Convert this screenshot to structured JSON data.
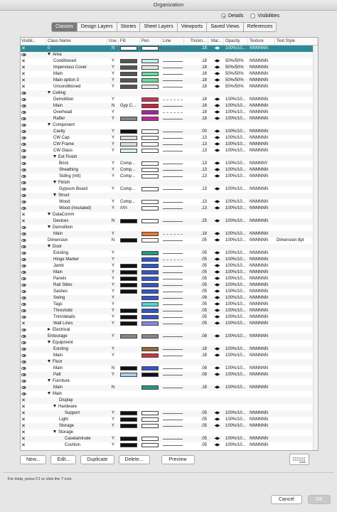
{
  "window": {
    "title": "Organization"
  },
  "view_mode": {
    "options": [
      "Details",
      "Visibilities"
    ],
    "selected": "Details"
  },
  "tabs": [
    "Classes",
    "Design Layers",
    "Stories",
    "Sheet Layers",
    "Viewports",
    "Saved Views",
    "References"
  ],
  "active_tab": "Classes",
  "columns": [
    "Visibil...",
    "Class Name",
    "Use",
    "Fill",
    "Pen",
    "Line",
    "Thickn...",
    "Mar...",
    "Opacity",
    "Texture",
    "Text Style"
  ],
  "rows": [
    {
      "vis": "x",
      "name": "0",
      "indent": 0,
      "tri": "",
      "use": "N",
      "fill": "#ffffff",
      "pen": "#ffffff",
      "line": "solid",
      "thick": ".18",
      "opac": "100%/10...",
      "tex": "NNNNNN",
      "ts": "",
      "sel": true
    },
    {
      "vis": "eye",
      "name": "Area",
      "indent": 0,
      "tri": "down",
      "use": "",
      "fill": "",
      "pen": "",
      "line": "",
      "thick": "",
      "opac": "",
      "tex": "",
      "ts": ""
    },
    {
      "vis": "x",
      "name": "Conditioned",
      "indent": 2,
      "tri": "",
      "use": "Y",
      "fill": "#555555",
      "pen": "#c8eaf0",
      "line": "solid",
      "thick": ".18",
      "opac": "50%/50%",
      "tex": "NNNNNN",
      "ts": ""
    },
    {
      "vis": "x",
      "name": "Impervious Cover",
      "indent": 2,
      "tri": "",
      "use": "Y",
      "fill": "#555555",
      "pen": "#e8e8e8",
      "line": "solid",
      "thick": ".18",
      "opac": "50%/50%",
      "tex": "NNNNNN",
      "ts": ""
    },
    {
      "vis": "x",
      "name": "Main",
      "indent": 2,
      "tri": "",
      "use": "Y",
      "fill": "#555555",
      "pen": "#66dd99",
      "line": "solid",
      "thick": ".18",
      "opac": "50%/50%",
      "tex": "NNNNNN",
      "ts": ""
    },
    {
      "vis": "x",
      "name": "Main option 3",
      "indent": 2,
      "tri": "",
      "use": "Y",
      "fill": "#555555",
      "pen": "#66dd99",
      "line": "solid",
      "thick": ".18",
      "opac": "50%/50%",
      "tex": "NNNNNN",
      "ts": ""
    },
    {
      "vis": "x",
      "name": "Unconditioned",
      "indent": 2,
      "tri": "",
      "use": "Y",
      "fill": "#555555",
      "pen": "#e8e8e8",
      "line": "solid",
      "thick": ".18",
      "opac": "50%/50%",
      "tex": "NNNNNN",
      "ts": ""
    },
    {
      "vis": "eye",
      "name": "Ceiling",
      "indent": 0,
      "tri": "down",
      "use": "",
      "fill": "",
      "pen": "",
      "line": "",
      "thick": "",
      "opac": "",
      "tex": "",
      "ts": ""
    },
    {
      "vis": "eye",
      "name": "Demolition",
      "indent": 2,
      "tri": "",
      "use": "Y",
      "fill": "",
      "pen": "#cc3355",
      "line": "dash",
      "thick": ".18",
      "opac": "100%/10...",
      "tex": "NNNNNN",
      "ts": ""
    },
    {
      "vis": "eye",
      "name": "Main",
      "indent": 2,
      "tri": "",
      "use": "N",
      "fill": "Gyp C...",
      "pen": "#cc2233",
      "line": "solid",
      "thick": ".18",
      "opac": "100%/10...",
      "tex": "NNNNNN",
      "ts": ""
    },
    {
      "vis": "eye",
      "name": "Overhead",
      "indent": 2,
      "tri": "",
      "use": "Y",
      "fill": "",
      "pen": "#aa2299",
      "line": "dash",
      "thick": ".18",
      "opac": "100%/10...",
      "tex": "NNNNNN",
      "ts": ""
    },
    {
      "vis": "eye",
      "name": "Rafter",
      "indent": 2,
      "tri": "",
      "use": "Y",
      "fill": "#888888",
      "pen": "#cc2299",
      "line": "solid",
      "thick": ".18",
      "opac": "100%/10...",
      "tex": "NNNNNN",
      "ts": ""
    },
    {
      "vis": "eye",
      "name": "Component",
      "indent": 0,
      "tri": "down",
      "use": "",
      "fill": "",
      "pen": "",
      "line": "",
      "thick": "",
      "opac": "",
      "tex": "",
      "ts": ""
    },
    {
      "vis": "eye",
      "name": "Cavity",
      "indent": 2,
      "tri": "",
      "use": "Y",
      "fill": "#111111",
      "pen": "#ffffff",
      "line": "solid",
      "thick": ".00",
      "opac": "100%/10...",
      "tex": "NNNNNN",
      "ts": ""
    },
    {
      "vis": "eye",
      "name": "CW Cap",
      "indent": 2,
      "tri": "",
      "use": "Y",
      "fill": "#dddddd",
      "pen": "#ffffff",
      "line": "solid",
      "thick": ".13",
      "opac": "100%/10...",
      "tex": "NNNNNN",
      "ts": ""
    },
    {
      "vis": "eye",
      "name": "CW Frame",
      "indent": 2,
      "tri": "",
      "use": "Y",
      "fill": "#dddddd",
      "pen": "#ffffff",
      "line": "solid",
      "thick": ".13",
      "opac": "100%/10...",
      "tex": "NNNNNN",
      "ts": ""
    },
    {
      "vis": "eye",
      "name": "CW Glass",
      "indent": 2,
      "tri": "",
      "use": "Y",
      "fill": "#d8eef2",
      "pen": "#ffffff",
      "line": "solid",
      "thick": ".13",
      "opac": "100%/10...",
      "tex": "NNNNNN",
      "ts": ""
    },
    {
      "vis": "eye",
      "name": "Ext Finish",
      "indent": 2,
      "tri": "down",
      "use": "",
      "fill": "",
      "pen": "",
      "line": "",
      "thick": "",
      "opac": "",
      "tex": "",
      "ts": ""
    },
    {
      "vis": "eye",
      "name": "Brick",
      "indent": 4,
      "tri": "",
      "use": "Y",
      "fill": "Comp...",
      "pen": "#ffffff",
      "line": "solid",
      "thick": ".13",
      "opac": "100%/10...",
      "tex": "NNNNNY",
      "ts": ""
    },
    {
      "vis": "eye",
      "name": "Sheathing",
      "indent": 4,
      "tri": "",
      "use": "Y",
      "fill": "Comp...",
      "pen": "#ffffff",
      "line": "solid",
      "thick": ".13",
      "opac": "100%/10...",
      "tex": "NNNNNN",
      "ts": ""
    },
    {
      "vis": "eye",
      "name": "Siding (mtl)",
      "indent": 4,
      "tri": "",
      "use": "Y",
      "fill": "Comp...",
      "pen": "#ffffff",
      "line": "solid",
      "thick": ".13",
      "opac": "100%/10...",
      "tex": "NNNNNN",
      "ts": ""
    },
    {
      "vis": "eye",
      "name": "Finish",
      "indent": 2,
      "tri": "down",
      "use": "",
      "fill": "",
      "pen": "",
      "line": "",
      "thick": "",
      "opac": "",
      "tex": "",
      "ts": ""
    },
    {
      "vis": "eye",
      "name": "Gypsum Board",
      "indent": 4,
      "tri": "",
      "use": "Y",
      "fill": "Comp...",
      "pen": "#ffffff",
      "line": "solid",
      "thick": ".13",
      "opac": "100%/10...",
      "tex": "NNNNNN",
      "ts": ""
    },
    {
      "vis": "eye",
      "name": "Struct",
      "indent": 2,
      "tri": "down",
      "use": "",
      "fill": "",
      "pen": "",
      "line": "",
      "thick": "",
      "opac": "",
      "tex": "",
      "ts": ""
    },
    {
      "vis": "eye",
      "name": "Wood",
      "indent": 4,
      "tri": "",
      "use": "Y",
      "fill": "Comp...",
      "pen": "#ffffff",
      "line": "solid",
      "thick": ".13",
      "opac": "100%/10...",
      "tex": "NNNNNN",
      "ts": ""
    },
    {
      "vis": "eye",
      "name": "Wood (insulated)",
      "indent": 4,
      "tri": "",
      "use": "Y",
      "fill": "/\\/\\/\\",
      "pen": "#ffffff",
      "line": "solid",
      "thick": ".13",
      "opac": "100%/10...",
      "tex": "NNNNNN",
      "ts": ""
    },
    {
      "vis": "x",
      "name": "DataComm",
      "indent": 0,
      "tri": "down",
      "use": "",
      "fill": "",
      "pen": "",
      "line": "",
      "thick": "",
      "opac": "",
      "tex": "",
      "ts": ""
    },
    {
      "vis": "x",
      "name": "Devices",
      "indent": 2,
      "tri": "",
      "use": "N",
      "fill": "#111111",
      "pen": "#ffffff",
      "line": "solid",
      "thick": ".25",
      "opac": "100%/10...",
      "tex": "NNNNNN",
      "ts": ""
    },
    {
      "vis": "eye",
      "name": "Demolition",
      "indent": 0,
      "tri": "down",
      "use": "",
      "fill": "",
      "pen": "",
      "line": "",
      "thick": "",
      "opac": "",
      "tex": "",
      "ts": ""
    },
    {
      "vis": "eye",
      "name": "Main",
      "indent": 2,
      "tri": "",
      "use": "Y",
      "fill": "",
      "pen": "#ee7733",
      "line": "dash",
      "thick": ".18",
      "opac": "100%/10...",
      "tex": "NNNNNN",
      "ts": ""
    },
    {
      "vis": "eye",
      "name": "Dimension",
      "indent": 0,
      "tri": "",
      "use": "N",
      "fill": "#111111",
      "pen": "#ffffff",
      "line": "solid",
      "thick": ".05",
      "opac": "100%/10...",
      "tex": "NNNNNN",
      "ts": "Dimension 8pt"
    },
    {
      "vis": "eye",
      "name": "Door",
      "indent": 0,
      "tri": "down",
      "use": "",
      "fill": "",
      "pen": "",
      "line": "",
      "thick": "",
      "opac": "",
      "tex": "",
      "ts": ""
    },
    {
      "vis": "eye",
      "name": "Existing",
      "indent": 2,
      "tri": "",
      "use": "Y",
      "fill": "",
      "pen": "#229988",
      "line": "solid",
      "thick": ".05",
      "opac": "100%/10...",
      "tex": "NNNNNN",
      "ts": ""
    },
    {
      "vis": "eye",
      "name": "Hinge Marker",
      "indent": 2,
      "tri": "",
      "use": "Y",
      "fill": "",
      "pen": "#3355cc",
      "line": "dash",
      "thick": ".05",
      "opac": "100%/10...",
      "tex": "NNNNNN",
      "ts": ""
    },
    {
      "vis": "eye",
      "name": "Jamb",
      "indent": 2,
      "tri": "",
      "use": "Y",
      "fill": "#111111",
      "pen": "#3355cc",
      "line": "solid",
      "thick": ".05",
      "opac": "100%/10...",
      "tex": "NNNNNN",
      "ts": ""
    },
    {
      "vis": "eye",
      "name": "Main",
      "indent": 2,
      "tri": "",
      "use": "Y",
      "fill": "#111111",
      "pen": "#3355cc",
      "line": "solid",
      "thick": ".05",
      "opac": "100%/10...",
      "tex": "NNNNNN",
      "ts": ""
    },
    {
      "vis": "eye",
      "name": "Panels",
      "indent": 2,
      "tri": "",
      "use": "Y",
      "fill": "#111111",
      "pen": "#3355cc",
      "line": "solid",
      "thick": ".05",
      "opac": "100%/10...",
      "tex": "NNNNNN",
      "ts": ""
    },
    {
      "vis": "eye",
      "name": "Rail Stiles",
      "indent": 2,
      "tri": "",
      "use": "Y",
      "fill": "#111111",
      "pen": "#3355cc",
      "line": "solid",
      "thick": ".05",
      "opac": "100%/10...",
      "tex": "NNNNNN",
      "ts": ""
    },
    {
      "vis": "eye",
      "name": "Sashes",
      "indent": 2,
      "tri": "",
      "use": "Y",
      "fill": "#111111",
      "pen": "#3355cc",
      "line": "solid",
      "thick": ".05",
      "opac": "100%/10...",
      "tex": "NNNNNN",
      "ts": ""
    },
    {
      "vis": "eye",
      "name": "Swing",
      "indent": 2,
      "tri": "",
      "use": "Y",
      "fill": "",
      "pen": "#3355cc",
      "line": "solid",
      "thick": ".08",
      "opac": "100%/10...",
      "tex": "NNNNNN",
      "ts": ""
    },
    {
      "vis": "eye",
      "name": "Tags",
      "indent": 2,
      "tri": "",
      "use": "Y",
      "fill": "",
      "pen": "#44dddd",
      "line": "solid",
      "thick": ".05",
      "opac": "100%/10...",
      "tex": "NNNNNN",
      "ts": ""
    },
    {
      "vis": "eye",
      "name": "Threshold",
      "indent": 2,
      "tri": "",
      "use": "Y",
      "fill": "#111111",
      "pen": "#3355cc",
      "line": "solid",
      "thick": ".05",
      "opac": "100%/10...",
      "tex": "NNNNNN",
      "ts": ""
    },
    {
      "vis": "eye",
      "name": "Trim/details",
      "indent": 2,
      "tri": "",
      "use": "Y",
      "fill": "#111111",
      "pen": "#3355cc",
      "line": "solid",
      "thick": ".05",
      "opac": "100%/10...",
      "tex": "NNNNNN",
      "ts": ""
    },
    {
      "vis": "x",
      "name": "Wall Lines",
      "indent": 2,
      "tri": "",
      "use": "Y",
      "fill": "#111111",
      "pen": "#8888dd",
      "line": "solid",
      "thick": ".05",
      "opac": "100%/10...",
      "tex": "NNNNNN",
      "ts": ""
    },
    {
      "vis": "eye",
      "name": "Electrical",
      "indent": 0,
      "tri": "right",
      "use": "",
      "fill": "",
      "pen": "",
      "line": "",
      "thick": "",
      "opac": "",
      "tex": "",
      "ts": ""
    },
    {
      "vis": "eye",
      "name": "Entourage",
      "indent": 0,
      "tri": "",
      "use": "Y",
      "fill": "#888888",
      "pen": "#888888",
      "line": "solid",
      "thick": ".08",
      "opac": "100%/10...",
      "tex": "NNNNNN",
      "ts": ""
    },
    {
      "vis": "eye",
      "name": "Equipment",
      "indent": 0,
      "tri": "down",
      "use": "",
      "fill": "",
      "pen": "",
      "line": "",
      "thick": "",
      "opac": "",
      "tex": "",
      "ts": ""
    },
    {
      "vis": "eye",
      "name": "Existing",
      "indent": 2,
      "tri": "",
      "use": "Y",
      "fill": "",
      "pen": "#996633",
      "line": "solid",
      "thick": ".18",
      "opac": "100%/10...",
      "tex": "NNNNNN",
      "ts": ""
    },
    {
      "vis": "eye",
      "name": "Main",
      "indent": 2,
      "tri": "",
      "use": "Y",
      "fill": "",
      "pen": "#cc3344",
      "line": "solid",
      "thick": ".18",
      "opac": "100%/10...",
      "tex": "NNNNNN",
      "ts": ""
    },
    {
      "vis": "eye",
      "name": "Floor",
      "indent": 0,
      "tri": "down",
      "use": "",
      "fill": "",
      "pen": "",
      "line": "",
      "thick": "",
      "opac": "",
      "tex": "",
      "ts": ""
    },
    {
      "vis": "eye",
      "name": "Main",
      "indent": 2,
      "tri": "",
      "use": "N",
      "fill": "#111111",
      "pen": "#3355cc",
      "line": "solid",
      "thick": ".08",
      "opac": "100%/10...",
      "tex": "NNNNNN",
      "ts": ""
    },
    {
      "vis": "eye",
      "name": "Patt",
      "indent": 2,
      "tri": "",
      "use": "Y",
      "fill": "#aaccee",
      "pen": "#111111",
      "line": "solid",
      "thick": ".08",
      "opac": "100%/10...",
      "tex": "NNNNNN",
      "ts": ""
    },
    {
      "vis": "eye",
      "name": "Furniture",
      "indent": 0,
      "tri": "down",
      "use": "",
      "fill": "",
      "pen": "",
      "line": "",
      "thick": "",
      "opac": "",
      "tex": "",
      "ts": ""
    },
    {
      "vis": "eye",
      "name": "Main",
      "indent": 2,
      "tri": "",
      "use": "N",
      "fill": "",
      "pen": "#229988",
      "line": "solid",
      "thick": ".18",
      "opac": "100%/10...",
      "tex": "NNNNNN",
      "ts": ""
    },
    {
      "vis": "eye",
      "name": "Main",
      "indent": 0,
      "tri": "down",
      "use": "",
      "fill": "",
      "pen": "",
      "line": "",
      "thick": "",
      "opac": "",
      "tex": "",
      "ts": ""
    },
    {
      "vis": "x",
      "name": "Display",
      "indent": 4,
      "tri": "",
      "use": "",
      "fill": "",
      "pen": "",
      "line": "",
      "thick": "",
      "opac": "",
      "tex": "",
      "ts": ""
    },
    {
      "vis": "x",
      "name": "Hardware",
      "indent": 2,
      "tri": "down",
      "use": "",
      "fill": "",
      "pen": "",
      "line": "",
      "thick": "",
      "opac": "",
      "tex": "",
      "ts": ""
    },
    {
      "vis": "x",
      "name": "Support",
      "indent": 6,
      "tri": "",
      "use": "Y",
      "fill": "#111111",
      "pen": "#ffffff",
      "line": "solid",
      "thick": ".05",
      "opac": "100%/10...",
      "tex": "NNNNNN",
      "ts": ""
    },
    {
      "vis": "x",
      "name": "Light",
      "indent": 4,
      "tri": "",
      "use": "Y",
      "fill": "#111111",
      "pen": "#ffffff",
      "line": "solid",
      "thick": ".05",
      "opac": "100%/10...",
      "tex": "NNNNNN",
      "ts": ""
    },
    {
      "vis": "x",
      "name": "Storage",
      "indent": 4,
      "tri": "",
      "use": "Y",
      "fill": "#111111",
      "pen": "#ffffff",
      "line": "solid",
      "thick": ".05",
      "opac": "100%/10...",
      "tex": "NNNNNN",
      "ts": ""
    },
    {
      "vis": "x",
      "name": "Storage",
      "indent": 2,
      "tri": "down",
      "use": "",
      "fill": "",
      "pen": "",
      "line": "",
      "thick": "",
      "opac": "",
      "tex": "",
      "ts": ""
    },
    {
      "vis": "x",
      "name": "Caselaminate",
      "indent": 6,
      "tri": "",
      "use": "Y",
      "fill": "#111111",
      "pen": "#ffffff",
      "line": "solid",
      "thick": ".05",
      "opac": "100%/10...",
      "tex": "NNNNNN",
      "ts": ""
    },
    {
      "vis": "x",
      "name": "Cushion",
      "indent": 6,
      "tri": "",
      "use": "Y",
      "fill": "#111111",
      "pen": "#ffffff",
      "line": "solid",
      "thick": ".05",
      "opac": "100%/10...",
      "tex": "NNNNNN",
      "ts": ""
    }
  ],
  "buttons": {
    "new": "New...",
    "edit": "Edit...",
    "duplicate": "Duplicate",
    "delete": "Delete...",
    "preview": "Preview"
  },
  "help_text": "For Help, press F1 or click the ? icon",
  "footer": {
    "cancel": "Cancel",
    "ok": "OK"
  }
}
